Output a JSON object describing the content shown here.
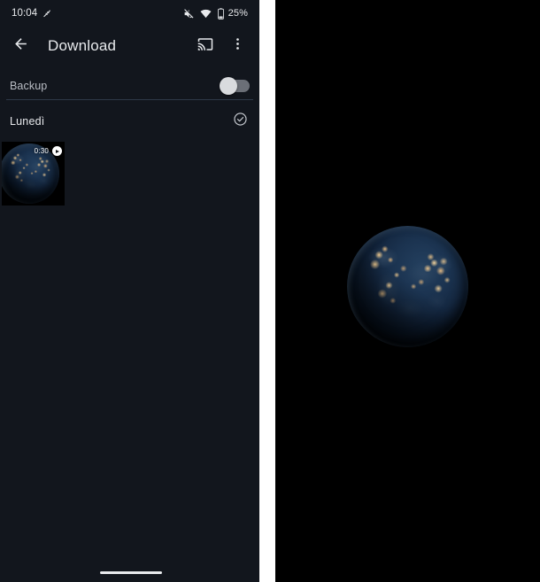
{
  "left_phone": {
    "status_bar": {
      "clock": "10:04",
      "status_icon_left": "vpn-key-icon",
      "mute_icon": "volume-off-icon",
      "wifi_icon": "wifi-icon",
      "battery_icon": "battery-icon",
      "battery_text": "25%"
    },
    "app_bar": {
      "back_icon": "arrow-back-icon",
      "title": "Download",
      "cast_icon": "cast-icon",
      "more_icon": "more-vert-icon"
    },
    "settings_row": {
      "label": "Backup",
      "toggle_state": "off"
    },
    "section": {
      "day_label": "Lunedì",
      "select_icon": "check-circle-icon"
    },
    "media_item": {
      "duration": "0:30",
      "play_icon": "play-circle-icon",
      "content": "earth-at-night-globe"
    },
    "nav": {
      "home_indicator": "home-gesture-bar"
    }
  },
  "right_phone": {
    "content": "earth-at-night-globe",
    "background_color": "#000000"
  },
  "colors": {
    "left_background": "#12161d",
    "right_background": "#000000",
    "text_primary": "#e8eaed",
    "text_secondary": "#b9bdc4",
    "divider": "#2e3947",
    "toggle_track": "#6b6f77",
    "toggle_knob": "#d9dbde"
  }
}
